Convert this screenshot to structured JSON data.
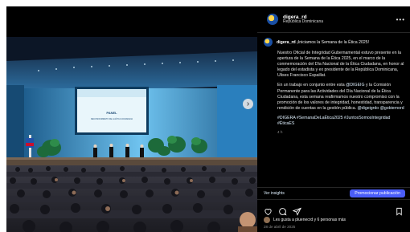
{
  "header": {
    "username": "digera_rd",
    "location": "República Dominicana",
    "more_icon": "more-horizontal-icon"
  },
  "stage_screen": {
    "line1": "PANEL",
    "line2": "RECONOCIMIENTO DE LA ÉTICA CIUDADANA"
  },
  "caption": {
    "username": "digera_rd",
    "title": "¡Iniciamos la Semana de la Ética 2025!",
    "paragraph1": "Nuestro Oficial de Integridad Gubernamental estuvo presente en la apertura de la Semana de la Ética 2025, en el marco de la conmemoración del Día Nacional de la Ética Ciudadana, en honor al legado del estadista y ex presidente de la República Dominicana, Ulises Francisco Espaillat.",
    "paragraph2_before": "En un trabajo en conjunto entre esta ",
    "paragraph2_mention": "@DIGEIG",
    "paragraph2_after": " y la Comisión Permanente para las Actividades del Día Nacional de la Ética Ciudadana, esta semana reafirmamos nuestro compromiso con la promoción de los valores de integridad, honestidad, transparencia y rendición de cuentas en la gestión pública.",
    "paragraph2_mentions": "@digeigrdo @gobiernord",
    "hashtags": "#DIGERA #SemanaDeLaÉtica2025 #JuntosSomosIntegridad #ÉticaES",
    "time_ago": "4 h"
  },
  "insights": {
    "link_label": "Ver insights",
    "promote_label": "Promocionar publicación"
  },
  "actions": [
    "heart-icon",
    "comment-icon",
    "share-icon",
    "bookmark-icon"
  ],
  "likes": {
    "text": "Les gusta a pluenecrd y 6 personas más"
  },
  "date": "28 de abril de 2025",
  "colors": {
    "accent": "#4a5df9",
    "link": "#e0f1ff",
    "panel_bg": "#000000"
  }
}
